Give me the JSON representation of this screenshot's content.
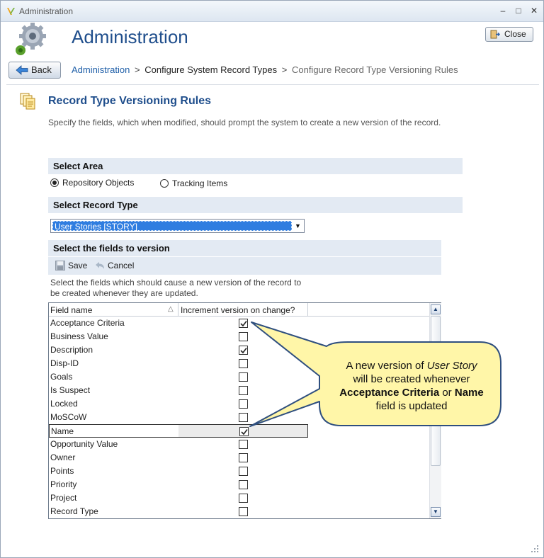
{
  "window": {
    "title": "Administration"
  },
  "header": {
    "title": "Administration",
    "close_label": "Close",
    "back_label": "Back"
  },
  "breadcrumb": {
    "items": [
      "Administration",
      "Configure System Record Types",
      "Configure Record Type Versioning Rules"
    ],
    "separator": ">"
  },
  "section": {
    "title": "Record Type Versioning Rules",
    "description": "Specify the fields, which when modified, should prompt the system to create a new version of the record."
  },
  "select_area": {
    "heading": "Select Area",
    "options": [
      {
        "label": "Repository Objects",
        "selected": true
      },
      {
        "label": "Tracking Items",
        "selected": false
      }
    ]
  },
  "select_record_type": {
    "heading": "Select Record Type",
    "value": "User Stories [STORY]"
  },
  "fields_section": {
    "heading": "Select the fields to version",
    "save_label": "Save",
    "cancel_label": "Cancel",
    "instructions": "Select the fields which should cause a new version of the record to be created whenever they are updated."
  },
  "grid": {
    "columns": [
      "Field name",
      "Increment version on change?"
    ],
    "rows": [
      {
        "name": "Acceptance Criteria",
        "checked": true
      },
      {
        "name": "Business Value",
        "checked": false
      },
      {
        "name": "Description",
        "checked": true
      },
      {
        "name": "Disp-ID",
        "checked": false
      },
      {
        "name": "Goals",
        "checked": false
      },
      {
        "name": "Is Suspect",
        "checked": false
      },
      {
        "name": "Locked",
        "checked": false
      },
      {
        "name": "MoSCoW",
        "checked": false
      },
      {
        "name": "Name",
        "checked": true,
        "selected": true
      },
      {
        "name": "Opportunity Value",
        "checked": false
      },
      {
        "name": "Owner",
        "checked": false
      },
      {
        "name": "Points",
        "checked": false
      },
      {
        "name": "Priority",
        "checked": false
      },
      {
        "name": "Project",
        "checked": false
      },
      {
        "name": "Record Type",
        "checked": false
      }
    ]
  },
  "callout": {
    "line1_pre": "A new version of ",
    "line1_em": "User Story",
    "line2": "will be created whenever",
    "line3_a": "Acceptance Criteria",
    "line3_or": " or ",
    "line3_b": "Name",
    "line4": "field is updated"
  },
  "colors": {
    "accent": "#1f4e8c",
    "link": "#1f5fa8",
    "band": "#e3eaf3",
    "callout_fill": "#fff6a8",
    "callout_stroke": "#2f4f7f"
  }
}
